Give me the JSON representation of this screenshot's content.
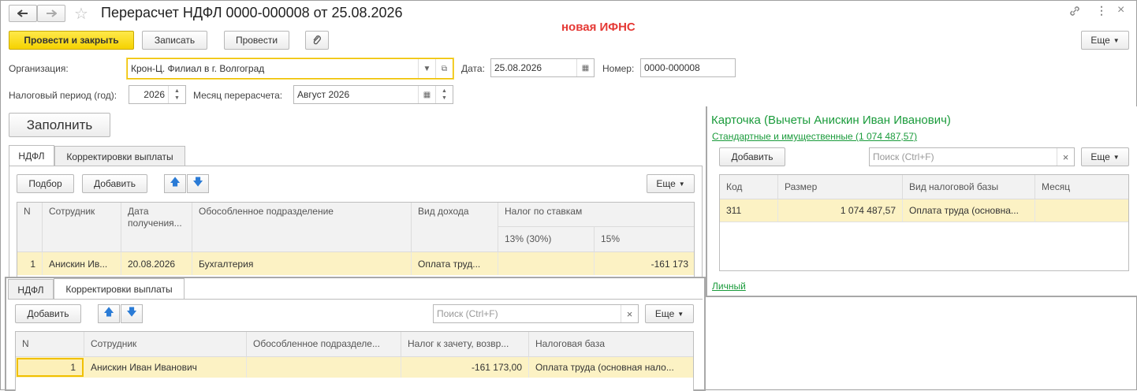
{
  "window": {
    "title": "Перерасчет НДФЛ 0000-000008 от 25.08.2026",
    "annotation": "новая ИФНС",
    "more": "Еще"
  },
  "toolbar": {
    "post_close": "Провести и закрыть",
    "save": "Записать",
    "post": "Провести"
  },
  "form": {
    "org_label": "Организация:",
    "org_value": "Крон-Ц. Филиал в г. Волгоград",
    "date_label": "Дата:",
    "date_value": "25.08.2026",
    "num_label": "Номер:",
    "num_value": "0000-000008",
    "period_label": "Налоговый период (год):",
    "period_value": "2026",
    "month_label": "Месяц перерасчета:",
    "month_value": "Август 2026",
    "fill": "Заполнить"
  },
  "tabs": [
    "НДФЛ",
    "Корректировки выплаты"
  ],
  "ndfl": {
    "selection": "Подбор",
    "add": "Добавить",
    "more": "Еще",
    "headers": {
      "n": "N",
      "emp": "Сотрудник",
      "date": "Дата получения...",
      "dept": "Обособленное подразделение",
      "kind": "Вид дохода",
      "tax": "Налог по ставкам",
      "r13": "13% (30%)",
      "r15": "15%"
    },
    "rows": [
      {
        "n": "1",
        "emp": "Анискин Ив...",
        "date": "20.08.2026",
        "dept": "Бухгалтерия",
        "kind": "Оплата труд...",
        "r13": "",
        "r15": "-161 173"
      }
    ]
  },
  "korr": {
    "add": "Добавить",
    "search_placeholder": "Поиск (Ctrl+F)",
    "more": "Еще",
    "headers": {
      "n": "N",
      "emp": "Сотрудник",
      "dept": "Обособленное подразделе...",
      "tax": "Налог к зачету, возвр...",
      "base": "Налоговая база"
    },
    "rows": [
      {
        "n": "1",
        "emp": "Анискин Иван Иванович",
        "dept": "",
        "tax": "-161 173,00",
        "base": "Оплата труда (основная нало..."
      }
    ]
  },
  "card": {
    "title": "Карточка (Вычеты Анискин Иван Иванович)",
    "link": "Стандартные и имущественные (1 074 487,57)",
    "add": "Добавить",
    "search_placeholder": "Поиск (Ctrl+F)",
    "more": "Еще",
    "headers": {
      "code": "Код",
      "size": "Размер",
      "base": "Вид налоговой базы",
      "month": "Месяц"
    },
    "rows": [
      {
        "code": "311",
        "size": "1 074 487,57",
        "base": "Оплата труда (основна...",
        "month": ""
      }
    ],
    "personal": "Личный"
  },
  "colors": {
    "accent": "#f5d200",
    "link": "#1a9b3b",
    "annotation": "#e53935"
  }
}
